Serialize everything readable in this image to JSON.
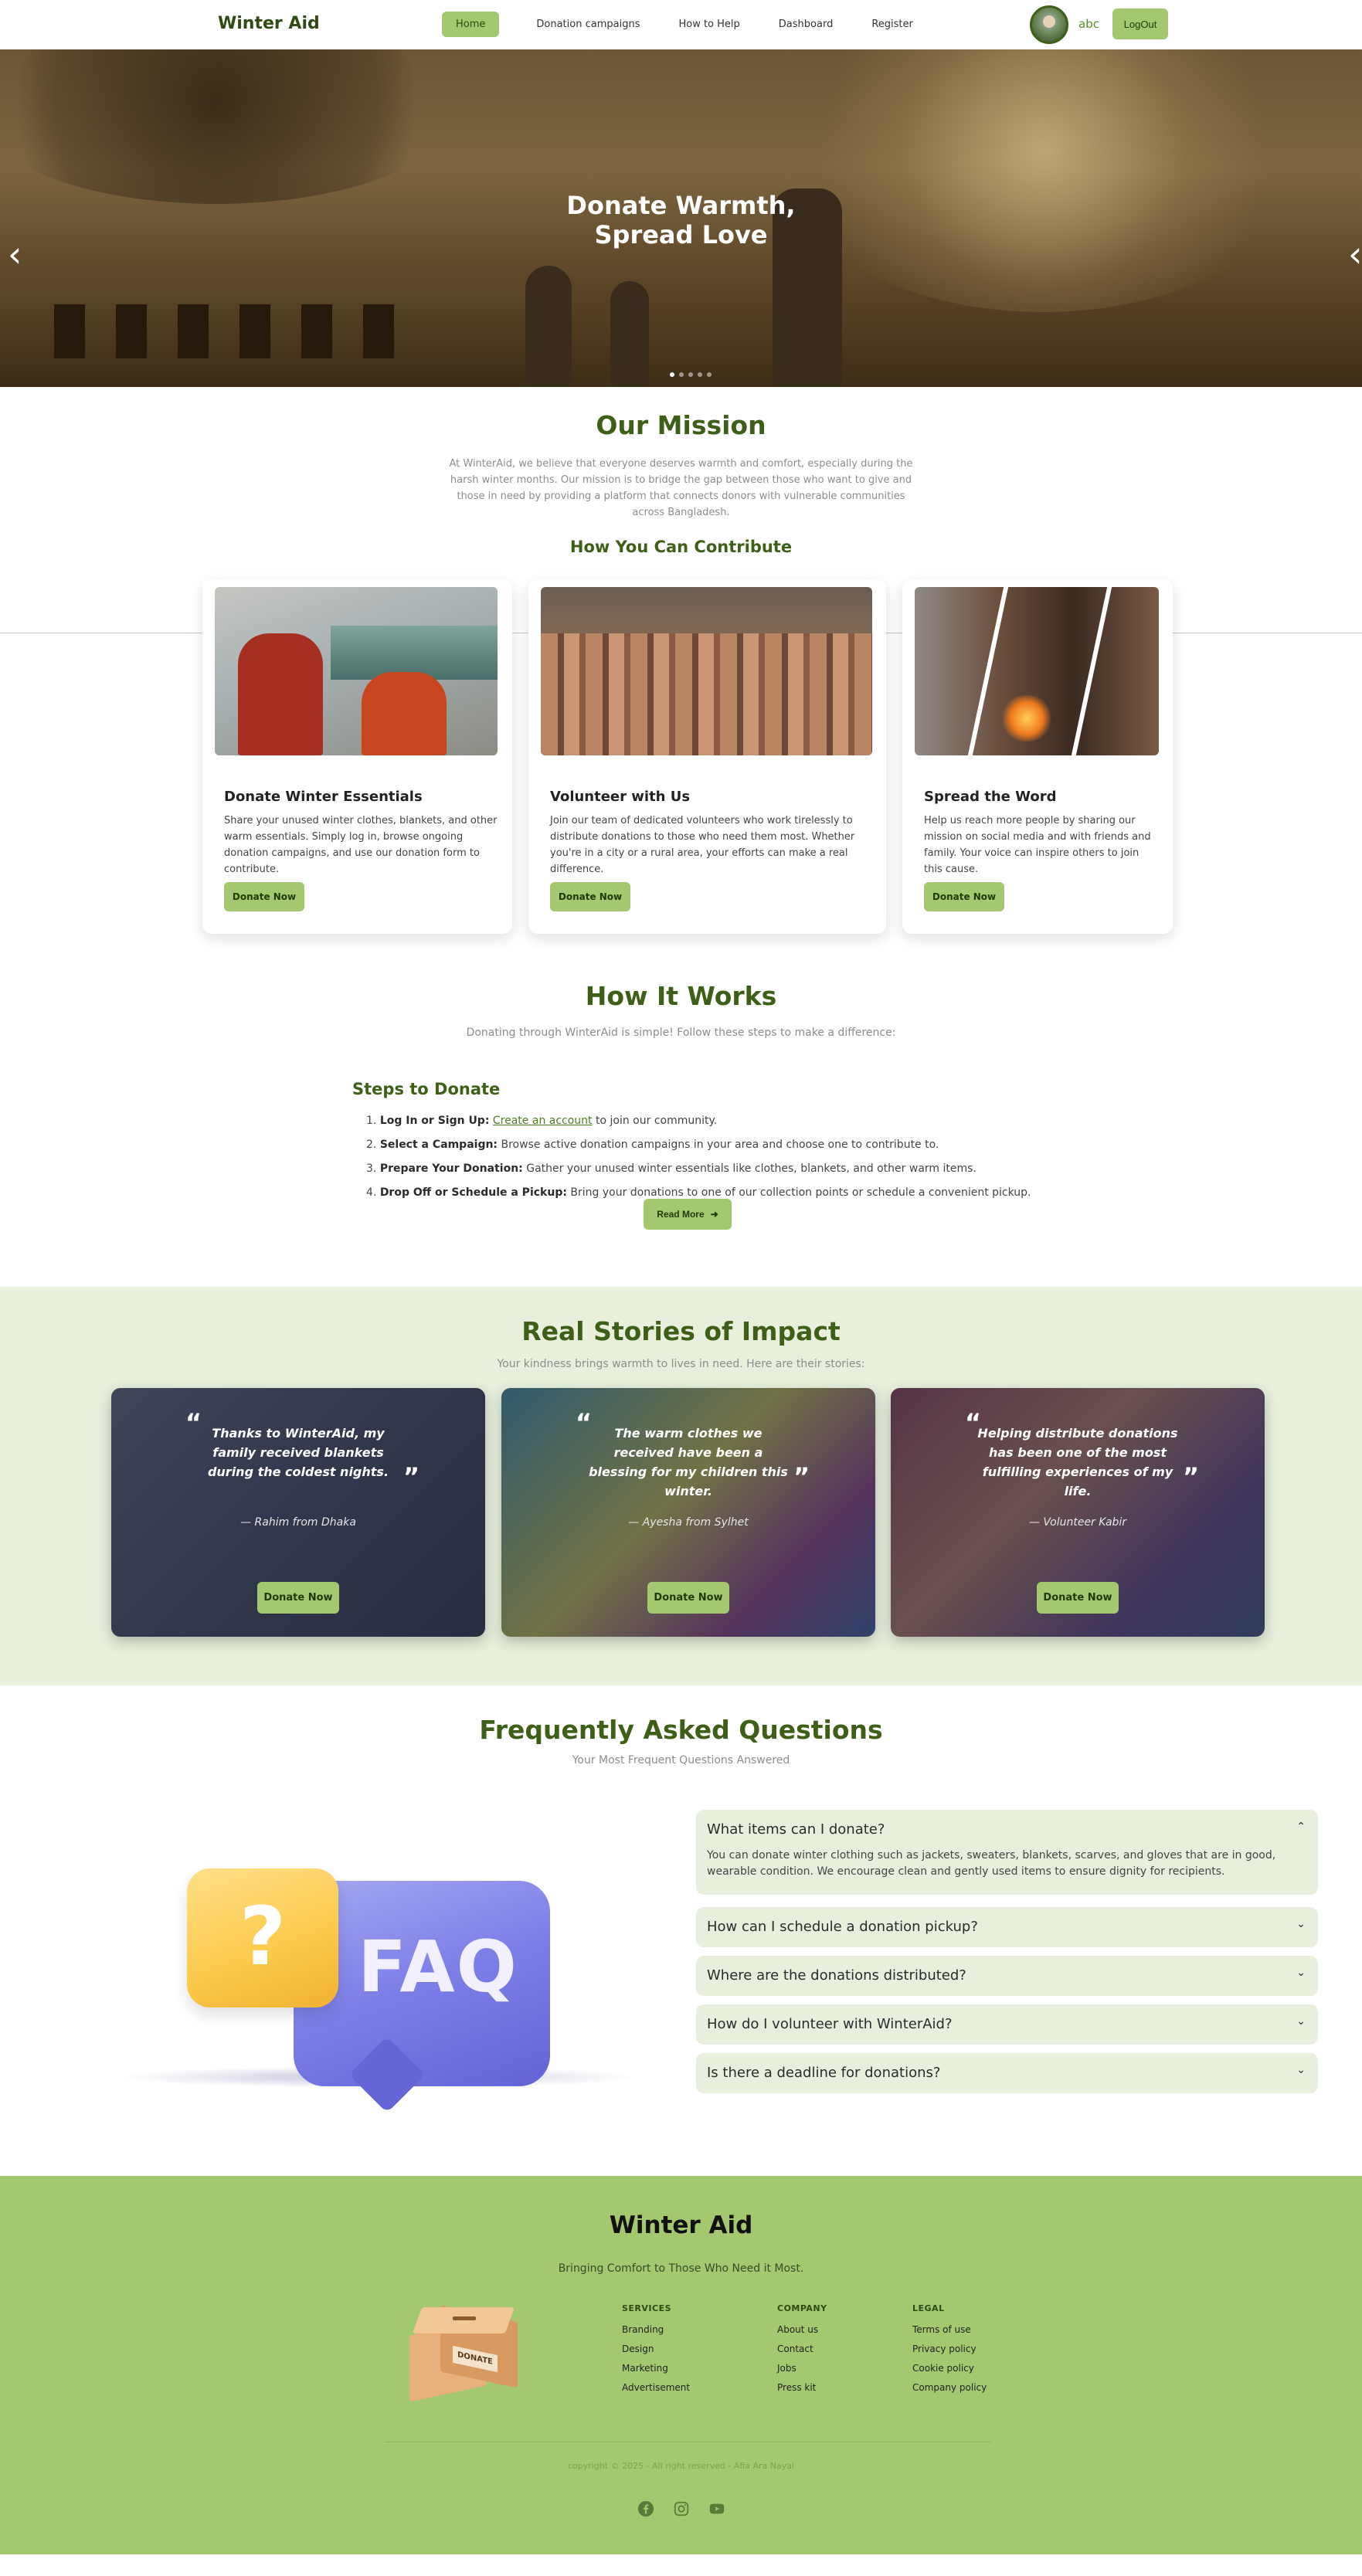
{
  "nav": {
    "brand": "Winter Aid",
    "links": [
      "Home",
      "Donation campaigns",
      "How to Help",
      "Dashboard",
      "Register"
    ],
    "username": "abc",
    "logout": "LogOut"
  },
  "hero": {
    "title_line1": "Donate Warmth,",
    "title_line2": "Spread Love",
    "prev_icon": "chevron-left-icon",
    "next_icon": "chevron-right-icon",
    "slide_count": 5,
    "active_slide": 1
  },
  "mission": {
    "title": "Our Mission",
    "text": "At WinterAid, we believe that everyone deserves warmth and comfort, especially during the harsh winter months. Our mission is to bridge the gap between those who want to give and those in need by providing a platform that connects donors with vulnerable communities across Bangladesh.",
    "contribute_title": "How You Can Contribute"
  },
  "contribute": [
    {
      "title": "Donate Winter Essentials",
      "text": "Share your unused winter clothes, blankets, and other warm essentials. Simply log in, browse ongoing donation campaigns, and use our donation form to contribute.",
      "button": "Donate Now"
    },
    {
      "title": "Volunteer with Us",
      "text": "Join our team of dedicated volunteers who work tirelessly to distribute donations to those who need them most. Whether you're in a city or a rural area, your efforts can make a real difference.",
      "button": "Donate Now"
    },
    {
      "title": "Spread the Word",
      "text": "Help us reach more people by sharing our mission on social media and with friends and family. Your voice can inspire others to join this cause.",
      "button": "Donate Now"
    }
  ],
  "how": {
    "title": "How It Works",
    "subtitle": "Donating through WinterAid is simple! Follow these steps to make a difference:",
    "steps_title": "Steps to Donate",
    "steps": [
      {
        "num": "1.",
        "bold": "Log In or Sign Up:",
        "link": "Create an account",
        "rest": " to join our community."
      },
      {
        "num": "2.",
        "bold": "Select a Campaign:",
        "rest": " Browse active donation campaigns in your area and choose one to contribute to."
      },
      {
        "num": "3.",
        "bold": "Prepare Your Donation:",
        "rest": " Gather your unused winter essentials like clothes, blankets, and other warm items."
      },
      {
        "num": "4.",
        "bold": "Drop Off or Schedule a Pickup:",
        "rest": " Bring your donations to one of our collection points or schedule a convenient pickup."
      }
    ],
    "read_more": "Read More"
  },
  "stories": {
    "title": "Real Stories of Impact",
    "subtitle": "Your kindness brings warmth to lives in need. Here are their stories:",
    "items": [
      {
        "quote": "Thanks to WinterAid, my family received blankets during the coldest nights.",
        "author": "— Rahim from Dhaka",
        "button": "Donate Now"
      },
      {
        "quote": "The warm clothes we received have been a blessing for my children this winter.",
        "author": "— Ayesha from Sylhet",
        "button": "Donate Now"
      },
      {
        "quote": "Helping distribute donations has been one of the most fulfilling experiences of my life.",
        "author": "— Volunteer Kabir",
        "button": "Donate Now"
      }
    ]
  },
  "faq": {
    "title": "Frequently Asked Questions",
    "subtitle": "Your Most Frequent Questions Answered",
    "art_text": "FAQ",
    "art_mark": "?",
    "items": [
      {
        "q": "What items can I donate?",
        "a": "You can donate winter clothing such as jackets, sweaters, blankets, scarves, and gloves that are in good, wearable condition. We encourage clean and gently used items to ensure dignity for recipients.",
        "open": true
      },
      {
        "q": "How can I schedule a donation pickup?",
        "open": false
      },
      {
        "q": "Where are the donations distributed?",
        "open": false
      },
      {
        "q": "How do I volunteer with WinterAid?",
        "open": false
      },
      {
        "q": "Is there a deadline for donations?",
        "open": false
      }
    ]
  },
  "footer": {
    "title": "Winter Aid",
    "tagline": "Bringing Comfort to Those Who Need it Most.",
    "box_label": "DONATE",
    "columns": [
      {
        "title": "SERVICES",
        "links": [
          "Branding",
          "Design",
          "Marketing",
          "Advertisement"
        ]
      },
      {
        "title": "COMPANY",
        "links": [
          "About us",
          "Contact",
          "Jobs",
          "Press kit"
        ]
      },
      {
        "title": "LEGAL",
        "links": [
          "Terms of use",
          "Privacy policy",
          "Cookie policy",
          "Company policy"
        ]
      }
    ],
    "copyright": "copyright © 2025 - All right reserved - Afia Ara Nayal",
    "social": [
      "facebook-icon",
      "instagram-icon",
      "youtube-icon"
    ]
  },
  "colors": {
    "accent": "#a3c86f",
    "heading": "#3d5f17",
    "light_bg": "#e8f0dd"
  }
}
